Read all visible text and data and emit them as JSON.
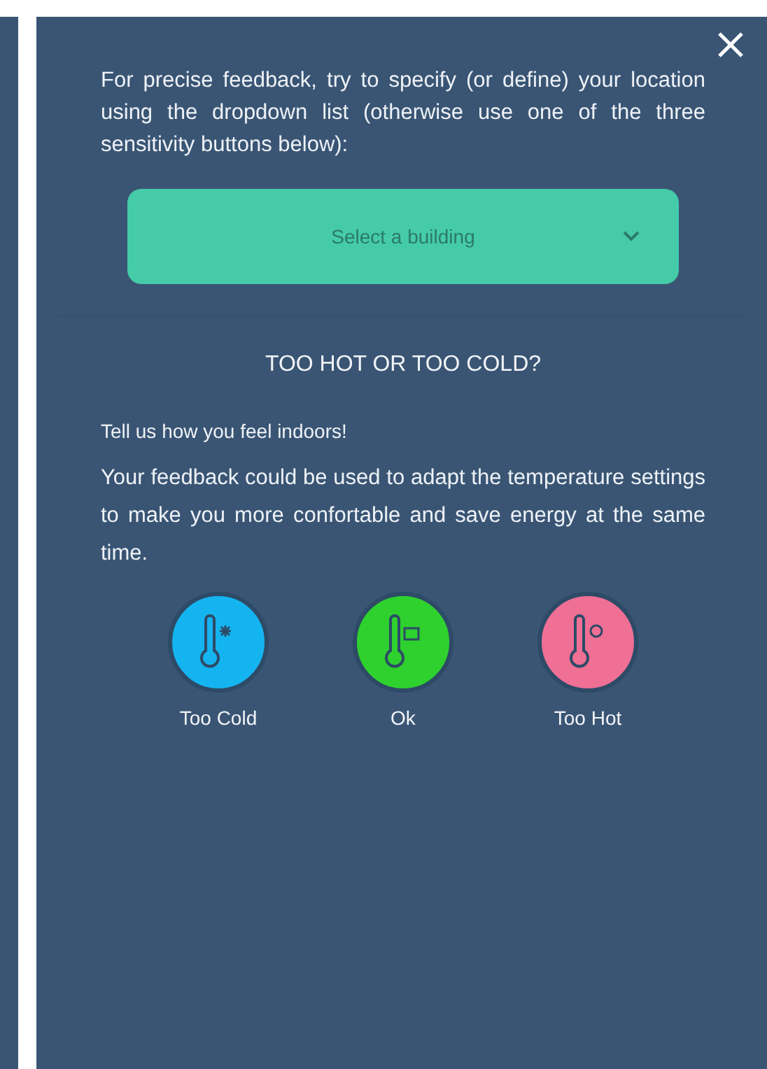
{
  "intro": "For precise feedback, try to specify (or define) your location using the dropdown list (otherwise use one of the three sensitivity buttons below):",
  "dropdown": {
    "placeholder": "Select a building"
  },
  "heading": "TOO HOT OR TOO COLD?",
  "prompt": "Tell us how you feel indoors!",
  "explanation": "Your feedback could be used to adapt the temperature settings to make you more confortable and save energy at the same time.",
  "options": [
    {
      "kind": "cold",
      "label": "Too Cold",
      "color": "#14b4f0"
    },
    {
      "kind": "ok",
      "label": "Ok",
      "color": "#2ed12e"
    },
    {
      "kind": "hot",
      "label": "Too Hot",
      "color": "#ef6f95"
    }
  ]
}
